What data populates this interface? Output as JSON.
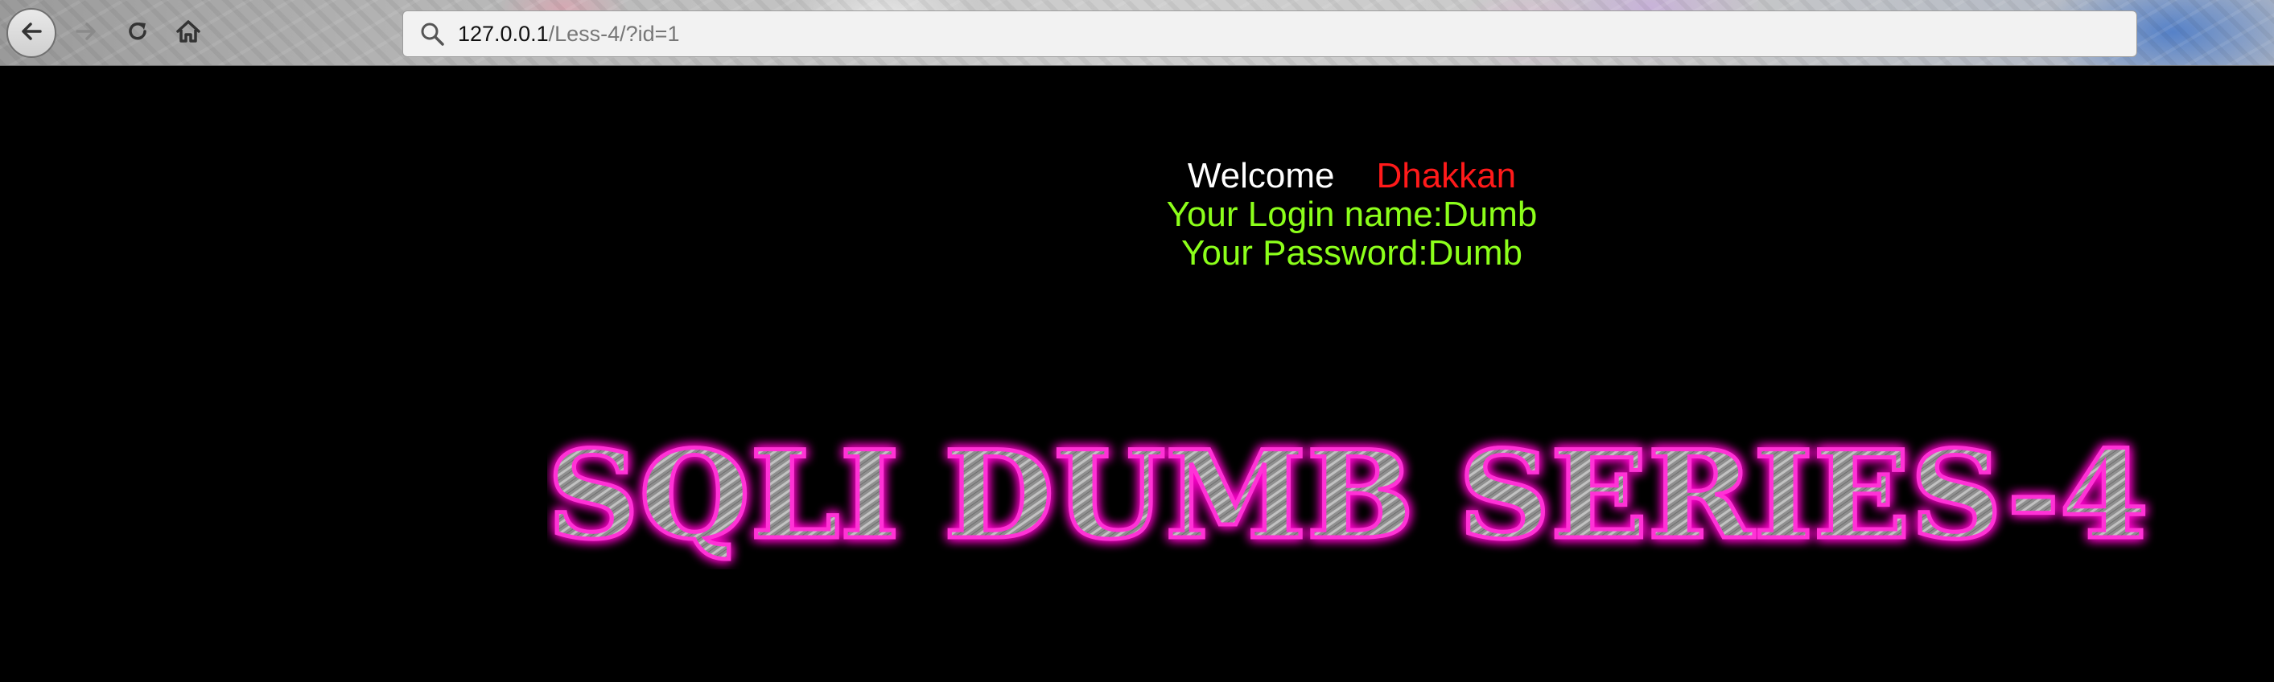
{
  "browser": {
    "url_host": "127.0.0.1",
    "url_path": "/Less-4/?id=1",
    "icons": {
      "back": "back-arrow-icon",
      "forward": "forward-arrow-icon",
      "reload": "reload-icon",
      "home": "home-icon",
      "search": "search-icon"
    }
  },
  "page": {
    "welcome_label": "Welcome",
    "user_label": "Dhakkan",
    "login_line": "Your Login name:Dumb",
    "password_line": "Your Password:Dumb",
    "banner_text": "SQLI DUMB SERIES-4"
  },
  "colors": {
    "background": "#000000",
    "welcome": "#ffffff",
    "user": "#ff1a1a",
    "credentials": "#8cff1a",
    "banner_glow": "#ff00cc",
    "banner_fill": "#9a9a9a"
  }
}
